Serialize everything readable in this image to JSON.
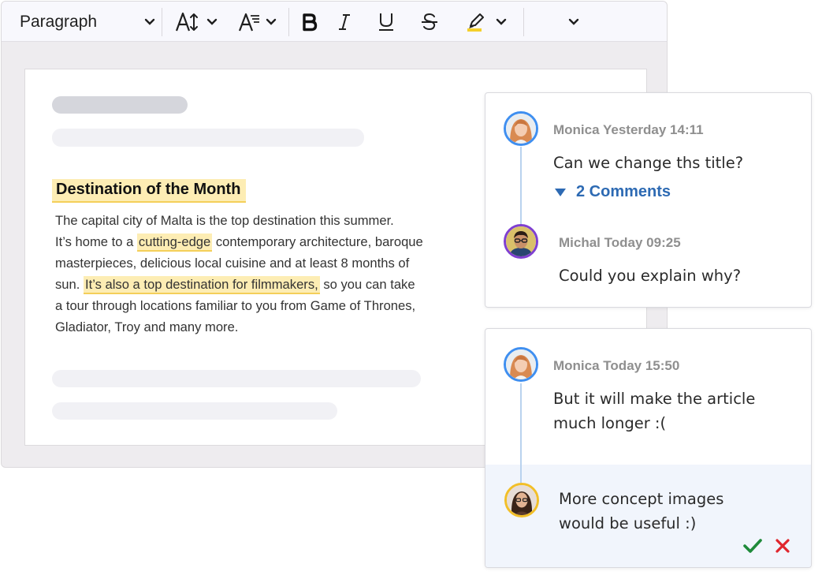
{
  "toolbar": {
    "paragraph_label": "Paragraph",
    "icons": [
      "font-size-icon",
      "font-family-icon",
      "bold-icon",
      "italic-icon",
      "underline-icon",
      "strikethrough-icon",
      "highlight-icon",
      "more-chevron-icon"
    ]
  },
  "document": {
    "title": "Destination of the Month",
    "lines": [
      {
        "before": "The capital city of Malta is the top destination this summer.",
        "mark": "",
        "after": ""
      },
      {
        "before": "It’s home to a ",
        "mark": "cutting-edge",
        "after": " contemporary architecture, baroque"
      },
      {
        "before": "masterpieces, delicious local cuisine and at least 8 months of",
        "mark": "",
        "after": ""
      },
      {
        "before": "sun. ",
        "mark": "It’s also a top destination for filmmakers,",
        "after": " so you can take"
      },
      {
        "before": "a tour through locations familiar to you from Game of Thrones,",
        "mark": "",
        "after": ""
      },
      {
        "before": "Gladiator, Troy and many more.",
        "mark": "",
        "after": ""
      }
    ],
    "highlight_color": "#fdedb4"
  },
  "threads": [
    {
      "comments": [
        {
          "author": "Monica",
          "time": "Yesterday 14:11",
          "text": [
            "Can we change ths title?"
          ],
          "avatar_ring": "#3f8ff0"
        },
        {
          "author": "Michal",
          "time": "Today 09:25",
          "text": [
            "Could you explain why?"
          ],
          "avatar_ring": "#7f3fd1"
        }
      ],
      "collapse_label": "2 Comments"
    },
    {
      "comments": [
        {
          "author": "Monica",
          "time": "Today 15:50",
          "text": [
            "But it will make the article",
            "much longer :("
          ],
          "avatar_ring": "#3f8ff0"
        }
      ],
      "reply": {
        "text": [
          "More concept images",
          "would be useful :)"
        ],
        "avatar_ring": "#f2bf28"
      },
      "actions": {
        "confirm_color": "#1f8a3a",
        "cancel_color": "#e0262d"
      }
    }
  ]
}
